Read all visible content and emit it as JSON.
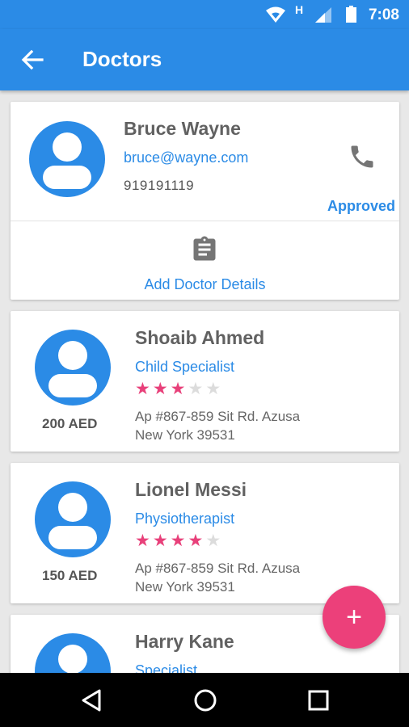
{
  "status_bar": {
    "time": "7:08",
    "network_label": "H"
  },
  "app_bar": {
    "title": "Doctors"
  },
  "profile_card": {
    "name": "Bruce Wayne",
    "email": "bruce@wayne.com",
    "phone": "919191119",
    "status": "Approved",
    "add_details_label": "Add Doctor Details"
  },
  "doctors": [
    {
      "name": "Shoaib Ahmed",
      "specialty": "Child Specialist",
      "rating": 3,
      "rating_max": 5,
      "price": "200 AED",
      "address_line1": "Ap #867-859 Sit Rd. Azusa",
      "address_line2": "New York 39531"
    },
    {
      "name": "Lionel Messi",
      "specialty": "Physiotherapist",
      "rating": 4,
      "rating_max": 5,
      "price": "150 AED",
      "address_line1": "Ap #867-859 Sit Rd. Azusa",
      "address_line2": "New York 39531"
    },
    {
      "name": "Harry Kane",
      "specialty": "Specialist"
    }
  ],
  "fab": {
    "label": "+"
  },
  "colors": {
    "primary": "#2b8be6",
    "accent": "#ec407a"
  }
}
